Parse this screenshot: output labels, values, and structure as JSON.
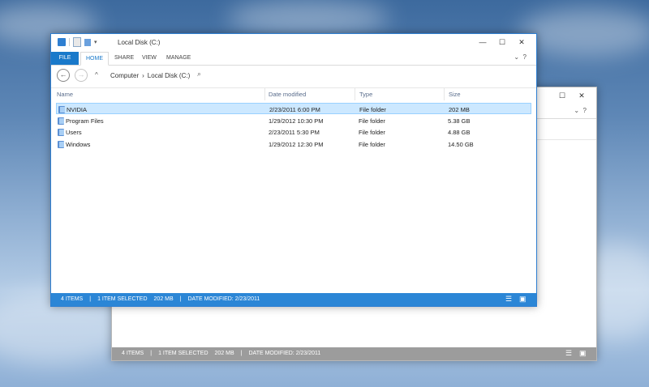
{
  "front_window": {
    "title": "Local Disk (C:)",
    "caption": {
      "minimize": "—",
      "maximize": "☐",
      "close": "✕"
    },
    "ribbon_tabs": [
      "FILE",
      "HOME",
      "SHARE",
      "VIEW",
      "MANAGE"
    ],
    "ribbon_right": {
      "expand": "⌄",
      "help": "?"
    },
    "address": {
      "computer": "Computer",
      "sep": "›",
      "location": "Local Disk (C:)"
    },
    "columns": [
      "Name",
      "Date modified",
      "Type",
      "Size"
    ],
    "rows": [
      {
        "name": "NVIDIA",
        "date": "2/23/2011 6:00 PM",
        "type": "File folder",
        "size": "202 MB"
      },
      {
        "name": "Program Files",
        "date": "1/29/2012 10:30 PM",
        "type": "File folder",
        "size": "5.38 GB"
      },
      {
        "name": "Users",
        "date": "2/23/2011 5:30 PM",
        "type": "File folder",
        "size": "4.88 GB"
      },
      {
        "name": "Windows",
        "date": "1/29/2012 12:30 PM",
        "type": "File folder",
        "size": "14.50 GB"
      }
    ],
    "status": {
      "items": "4 ITEMS",
      "sep": "|",
      "selected": "1 ITEM SELECTED",
      "size": "202 MB",
      "modified": "DATE MODIFIED: 2/23/2011"
    }
  },
  "back_window": {
    "caption": {
      "maximize": "☐",
      "close": "✕"
    },
    "ribbon_right": {
      "expand": "⌄",
      "help": "?"
    },
    "status": {
      "items": "4 ITEMS",
      "sep": "|",
      "selected": "1 ITEM SELECTED",
      "size": "202 MB",
      "modified": "DATE MODIFIED: 2/23/2011"
    }
  },
  "colors": {
    "accent": "#1979ca",
    "status_bar": "#2b86d6",
    "selection": "#cce8ff"
  }
}
